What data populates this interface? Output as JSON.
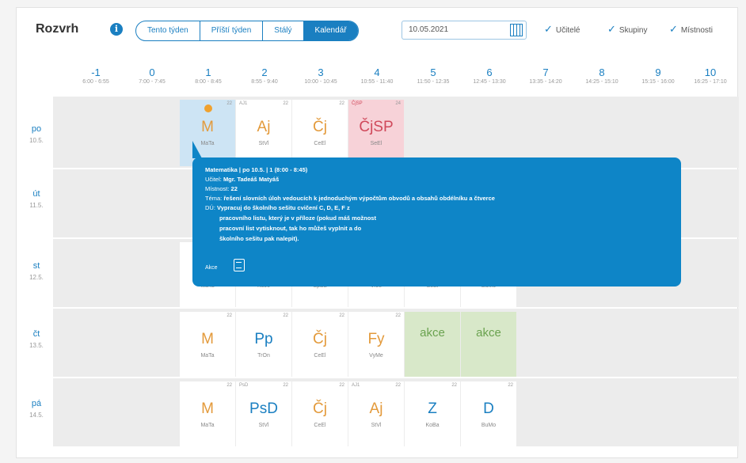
{
  "header": {
    "title": "Rozvrh",
    "tabs": [
      "Tento týden",
      "Příští týden",
      "Stálý",
      "Kalendář"
    ],
    "active_tab": 3,
    "date_value": "10.05.2021",
    "checks": [
      "Učitelé",
      "Skupiny",
      "Místnosti"
    ]
  },
  "periods": [
    {
      "num": "-1",
      "time": "6:00 - 6:55"
    },
    {
      "num": "0",
      "time": "7:00 - 7:45"
    },
    {
      "num": "1",
      "time": "8:00 - 8:45"
    },
    {
      "num": "2",
      "time": "8:55 - 9:40"
    },
    {
      "num": "3",
      "time": "10:00 - 10:45"
    },
    {
      "num": "4",
      "time": "10:55 - 11:40"
    },
    {
      "num": "5",
      "time": "11:50 - 12:35"
    },
    {
      "num": "6",
      "time": "12:45 - 13:30"
    },
    {
      "num": "7",
      "time": "13:35 - 14:20"
    },
    {
      "num": "8",
      "time": "14:25 - 15:10"
    },
    {
      "num": "9",
      "time": "15:15 - 16:00"
    },
    {
      "num": "10",
      "time": "16:25 - 17:10"
    }
  ],
  "days": [
    {
      "day": "po",
      "date": "10.5."
    },
    {
      "day": "út",
      "date": "11.5."
    },
    {
      "day": "st",
      "date": "12.5."
    },
    {
      "day": "čt",
      "date": "13.5."
    },
    {
      "day": "pá",
      "date": "14.5."
    }
  ],
  "lessons": {
    "po": [
      {
        "subj": "M",
        "tchr": "MaTa",
        "room": "22"
      },
      {
        "subj": "Aj",
        "tchr": "StVl",
        "room": "22",
        "group": "AJ1"
      },
      {
        "subj": "Čj",
        "tchr": "CeEl",
        "room": "22"
      },
      {
        "subj": "ČjSP",
        "tchr": "SeEl",
        "room": "24",
        "group": "ČjSP"
      }
    ],
    "st": [
      {
        "tchr": "MaTa"
      },
      {
        "tchr": "KoJo"
      },
      {
        "tchr": "SpBa"
      },
      {
        "tchr": "VrJe"
      },
      {
        "tchr": "SeEl"
      },
      {
        "tchr": "BuMo"
      }
    ],
    "ct": [
      {
        "subj": "M",
        "tchr": "MaTa",
        "room": "22"
      },
      {
        "subj": "Pp",
        "tchr": "TrOn",
        "room": "22"
      },
      {
        "subj": "Čj",
        "tchr": "CeEl",
        "room": "22"
      },
      {
        "subj": "Fy",
        "tchr": "VyMe",
        "room": "22"
      },
      {
        "subj": "akce"
      },
      {
        "subj": "akce"
      }
    ],
    "pa": [
      {
        "subj": "M",
        "tchr": "MaTa",
        "room": "22"
      },
      {
        "subj": "PsD",
        "tchr": "StVl",
        "room": "22",
        "group": "PsD"
      },
      {
        "subj": "Čj",
        "tchr": "CeEl",
        "room": "22"
      },
      {
        "subj": "Aj",
        "tchr": "StVl",
        "room": "22",
        "group": "AJ1"
      },
      {
        "subj": "Z",
        "tchr": "KoBa",
        "room": "22"
      },
      {
        "subj": "D",
        "tchr": "BuMo",
        "room": "22"
      }
    ]
  },
  "tooltip": {
    "title": "Matematika | po 10.5. | 1 (8:00 - 8:45)",
    "teacher_label": "Učitel:",
    "teacher": "Mgr. Tadeáš Matyáš",
    "room_label": "Místnost:",
    "room": "22",
    "topic_label": "Téma:",
    "topic": "řešení slovních úloh vedoucích k jednoduchým výpočtům obvodů a obsahů obdélníku a čtverce",
    "hw_label": "DÚ:",
    "hw_lines": [
      "Vypracuj do školního sešitu cvičení C, D, E, F z",
      "pracovního listu, který je v příloze (pokud máš možnost",
      "pracovní list vytisknout, tak ho můžeš vyplnit a do",
      "školního sešitu pak nalepit)."
    ],
    "action_label": "Akce"
  }
}
